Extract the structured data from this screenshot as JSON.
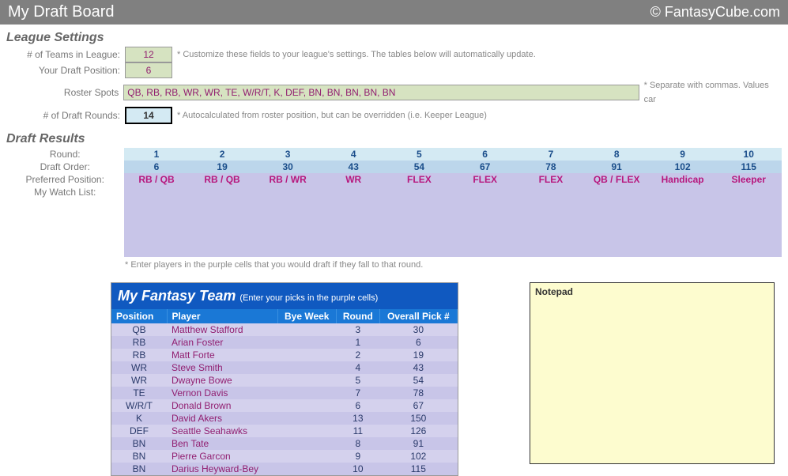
{
  "header": {
    "title": "My Draft Board",
    "brand": "© FantasyCube.com"
  },
  "settings": {
    "title": "League Settings",
    "rows": {
      "teams": {
        "label": "# of Teams in League:",
        "value": "12"
      },
      "position": {
        "label": "Your Draft Position:",
        "value": "6"
      },
      "roster": {
        "label": "Roster Spots",
        "value": "QB, RB, RB, WR, WR, TE, W/R/T, K, DEF, BN, BN, BN, BN, BN"
      },
      "rounds": {
        "label": "# of Draft Rounds:",
        "value": "14"
      }
    },
    "notes": {
      "customize": "* Customize these fields to your league's settings. The tables below will automatically update.",
      "separate": "* Separate with commas. Values car",
      "autocalc": "* Autocalculated from roster position, but can be overridden (i.e. Keeper League)"
    }
  },
  "draft": {
    "title": "Draft Results",
    "labels": {
      "round": "Round:",
      "order": "Draft Order:",
      "pref": "Preferred Position:",
      "watch": "My Watch List:"
    },
    "rounds": [
      "1",
      "2",
      "3",
      "4",
      "5",
      "6",
      "7",
      "8",
      "9",
      "10"
    ],
    "order": [
      "6",
      "19",
      "30",
      "43",
      "54",
      "67",
      "78",
      "91",
      "102",
      "115"
    ],
    "pref": [
      "RB / QB",
      "RB / QB",
      "RB / WR",
      "WR",
      "FLEX",
      "FLEX",
      "FLEX",
      "QB / FLEX",
      "Handicap",
      "Sleeper"
    ],
    "note": "* Enter players in the purple cells that you would draft if they fall to that round."
  },
  "team": {
    "title": "My Fantasy Team",
    "sub": "(Enter your picks in the purple cells)",
    "cols": {
      "pos": "Position",
      "player": "Player",
      "bye": "Bye Week",
      "round": "Round",
      "pick": "Overall Pick #"
    },
    "rows": [
      {
        "pos": "QB",
        "player": "Matthew Stafford",
        "round": "3",
        "pick": "30"
      },
      {
        "pos": "RB",
        "player": "Arian Foster",
        "round": "1",
        "pick": "6"
      },
      {
        "pos": "RB",
        "player": "Matt Forte",
        "round": "2",
        "pick": "19"
      },
      {
        "pos": "WR",
        "player": "Steve Smith",
        "round": "4",
        "pick": "43"
      },
      {
        "pos": "WR",
        "player": "Dwayne Bowe",
        "round": "5",
        "pick": "54"
      },
      {
        "pos": "TE",
        "player": "Vernon Davis",
        "round": "7",
        "pick": "78"
      },
      {
        "pos": "W/R/T",
        "player": "Donald Brown",
        "round": "6",
        "pick": "67"
      },
      {
        "pos": "K",
        "player": "David Akers",
        "round": "13",
        "pick": "150"
      },
      {
        "pos": "DEF",
        "player": "Seattle Seahawks",
        "round": "11",
        "pick": "126"
      },
      {
        "pos": "BN",
        "player": "Ben Tate",
        "round": "8",
        "pick": "91"
      },
      {
        "pos": "BN",
        "player": "Pierre Garcon",
        "round": "9",
        "pick": "102"
      },
      {
        "pos": "BN",
        "player": "Darius Heyward-Bey",
        "round": "10",
        "pick": "115"
      }
    ]
  },
  "notepad": {
    "title": "Notepad"
  }
}
